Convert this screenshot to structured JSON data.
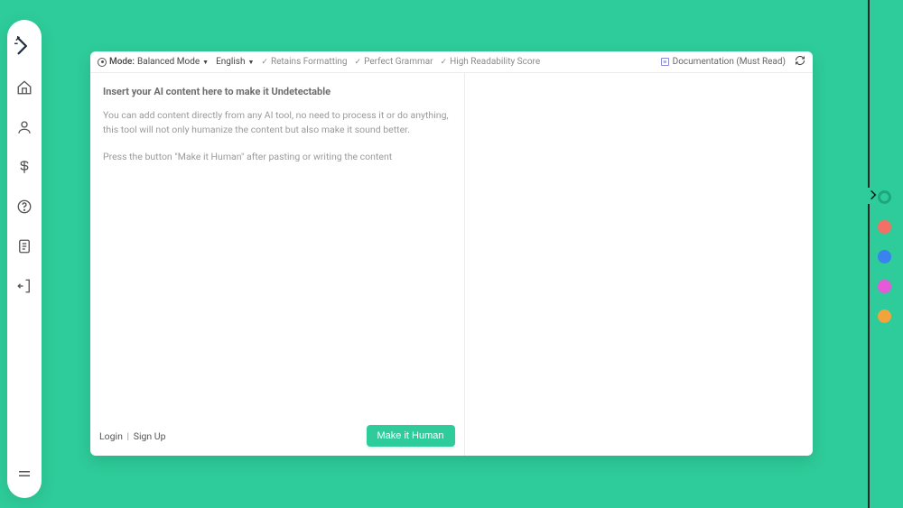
{
  "sidebar": {
    "items": [
      {
        "name": "home"
      },
      {
        "name": "profile"
      },
      {
        "name": "pricing"
      },
      {
        "name": "help"
      },
      {
        "name": "document"
      },
      {
        "name": "logout"
      }
    ]
  },
  "header": {
    "mode_label": "Mode:",
    "mode_value": "Balanced Mode",
    "language": "English",
    "features": [
      "Retains Formatting",
      "Perfect Grammar",
      "High Readability Score"
    ],
    "doc_link": "Documentation (Must Read)"
  },
  "editor": {
    "title": "Insert your AI content here to make it Undetectable",
    "para1": "You can add content directly from any AI tool, no need to process it or do anything, this tool will not only humanize the content but also make it sound better.",
    "para2": "Press the button \"Make it Human\" after pasting or writing the content",
    "button_label": "Make it Human",
    "login_label": "Login",
    "signup_label": "Sign Up"
  },
  "theme": {
    "accent": "#2ecc9a",
    "colors": [
      {
        "name": "green",
        "hex": "#1aa87c",
        "selected": true
      },
      {
        "name": "red",
        "hex": "#f27066",
        "selected": false
      },
      {
        "name": "blue",
        "hex": "#3a82f0",
        "selected": false
      },
      {
        "name": "pink",
        "hex": "#e45ad7",
        "selected": false
      },
      {
        "name": "orange",
        "hex": "#f2a33c",
        "selected": false
      }
    ]
  }
}
